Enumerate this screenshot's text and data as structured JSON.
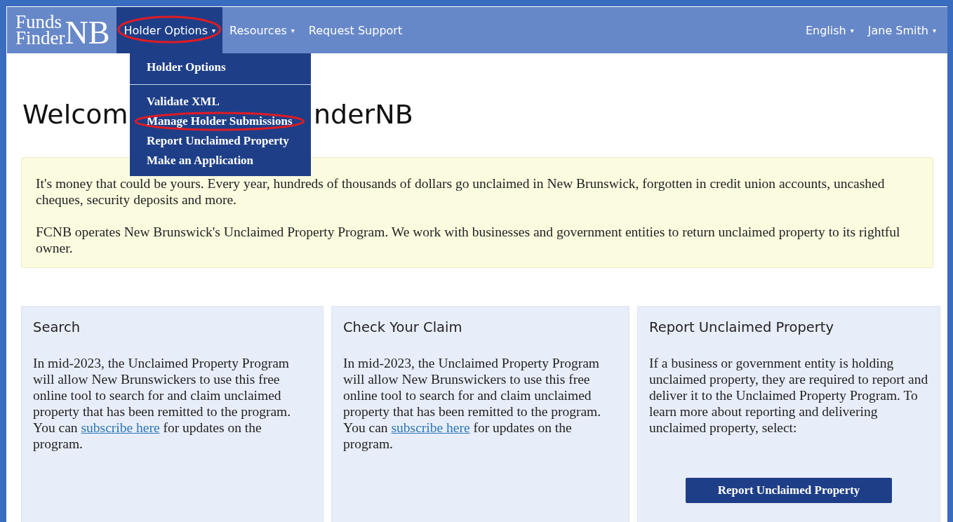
{
  "navbar": {
    "logo": {
      "line_1": "Funds",
      "line_2": "Finder",
      "suffix": "NB"
    },
    "menu": [
      {
        "label": "Holder Options",
        "caret": "▾",
        "selected": true,
        "highlighted": true
      },
      {
        "label": "Resources",
        "caret": "▾",
        "selected": false,
        "highlighted": false
      },
      {
        "label": "Request Support",
        "selected": false,
        "highlighted": false
      }
    ],
    "right_menu": [
      {
        "label": "English",
        "caret": "▾"
      },
      {
        "label": "Jane Smith",
        "caret": "▾"
      }
    ]
  },
  "dropdown": {
    "header": "Holder Options",
    "items": [
      {
        "label": "Validate XML",
        "highlighted": false
      },
      {
        "label": "Manage Holder Submissions",
        "highlighted": true
      },
      {
        "label": "Report Unclaimed Property",
        "highlighted": false
      },
      {
        "label": "Make an Application",
        "highlighted": false
      }
    ]
  },
  "heading": {
    "visible_start": "Welcom",
    "visible_end": "nderNB"
  },
  "notice": [
    "It's money that could be yours. Every year, hundreds of thousands of dollars go unclaimed in New Brunswick, forgotten in credit union accounts, uncashed cheques, security deposits and more.",
    "FCNB operates New Brunswick's Unclaimed Property Program. We work with businesses and government entities to return unclaimed property to its rightful owner."
  ],
  "cards": [
    {
      "title": "Search",
      "text": "In mid-2023, the Unclaimed Property Program will allow New Brunswickers to use this free online tool to search for and claim unclaimed property that has been remitted to the program. You can",
      "link": "subscribe here",
      "text_after": "for updates on the program."
    },
    {
      "title": "Check Your Claim",
      "text": "In mid-2023, the Unclaimed Property Program will allow New Brunswickers to use this free online tool to search for and claim unclaimed property that has been remitted to the program. You can",
      "link": "subscribe here",
      "text_after": "for updates on the program."
    },
    {
      "title": "Report Unclaimed Property",
      "text": "If a business or government entity is holding unclaimed property, they are required to report and deliver it to the Unclaimed Property Program. To learn more about reporting and delivering unclaimed property, select:",
      "button": "Report Unclaimed Property"
    }
  ]
}
